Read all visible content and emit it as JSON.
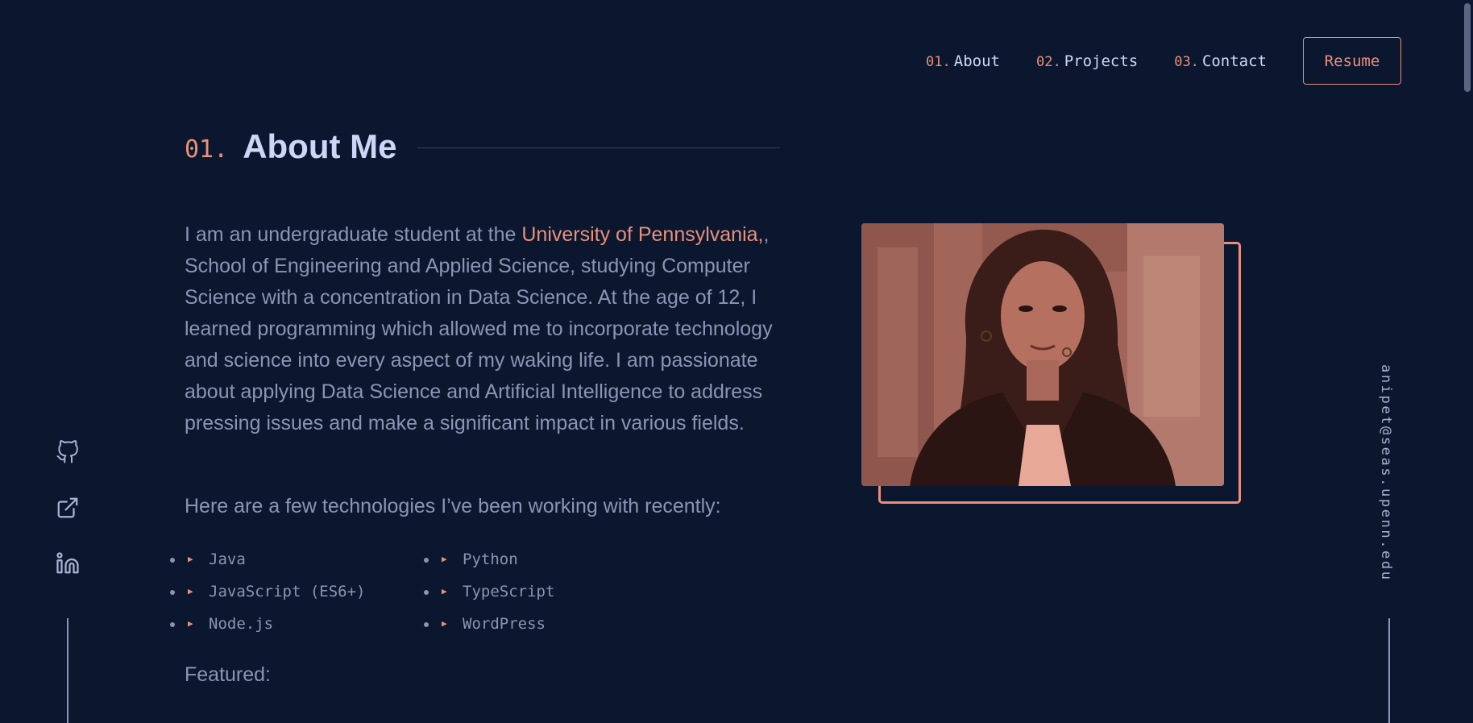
{
  "nav": {
    "items": [
      {
        "num": "01.",
        "label": "About"
      },
      {
        "num": "02.",
        "label": "Projects"
      },
      {
        "num": "03.",
        "label": "Contact"
      }
    ],
    "resume_label": "Resume"
  },
  "section": {
    "num": "01.",
    "title": "About Me"
  },
  "about": {
    "intro_before": "I am an undergraduate student at the ",
    "university": "University of Pennsylvania,",
    "intro_after": ", School of Engineering and Applied Science, studying Computer Science with a concentration in Data Science. At the age of 12, I learned programming which allowed me to incorporate technology and science into every aspect of my waking life. I am passionate about applying Data Science and Artificial Intelligence to address pressing issues and make a significant impact in various fields.",
    "tech_intro": "Here are a few technologies I’ve been working with recently:",
    "technologies": [
      "Java",
      "Python",
      "JavaScript (ES6+)",
      "TypeScript",
      "Node.js",
      "WordPress"
    ],
    "featured": "Featured:"
  },
  "social": {
    "icons": [
      "github-icon",
      "external-link-icon",
      "linkedin-icon"
    ]
  },
  "email": "anipet@seas.upenn.edu",
  "colors": {
    "background": "#0b172e",
    "accent": "#e8907a",
    "text": "#8a95b4",
    "heading": "#ccd6f6"
  }
}
